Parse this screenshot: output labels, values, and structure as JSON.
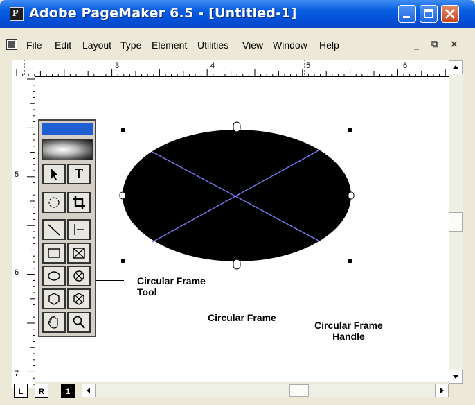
{
  "window": {
    "title": "Adobe PageMaker 6.5 - [Untitled-1]",
    "app_icon_letter": "P",
    "controls": [
      "minimize-icon",
      "maximize-icon",
      "close-icon"
    ]
  },
  "menu": {
    "items": [
      "File",
      "Edit",
      "Layout",
      "Type",
      "Element",
      "Utilities",
      "View",
      "Window",
      "Help"
    ],
    "mdi_controls": [
      "_",
      "⧉",
      "×"
    ]
  },
  "ruler": {
    "top_labels": [
      "3",
      "4",
      "5",
      "6"
    ],
    "left_labels": [
      "5",
      "6",
      "7"
    ]
  },
  "toolbox": {
    "tools": [
      {
        "name": "pointer-tool",
        "icon": "arrow-icon"
      },
      {
        "name": "text-tool",
        "icon": "text-t-icon",
        "label": "T"
      },
      {
        "name": "rotate-tool",
        "icon": "rotate-icon"
      },
      {
        "name": "crop-tool",
        "icon": "crop-icon"
      },
      {
        "name": "line-tool",
        "icon": "diagonal-line-icon"
      },
      {
        "name": "constrained-line-tool",
        "icon": "constrained-line-icon"
      },
      {
        "name": "rectangle-tool",
        "icon": "rectangle-icon"
      },
      {
        "name": "rectangle-frame-tool",
        "icon": "rectangle-frame-icon"
      },
      {
        "name": "ellipse-tool",
        "icon": "ellipse-icon"
      },
      {
        "name": "ellipse-frame-tool",
        "icon": "ellipse-frame-icon"
      },
      {
        "name": "polygon-tool",
        "icon": "polygon-icon"
      },
      {
        "name": "polygon-frame-tool",
        "icon": "polygon-frame-icon"
      },
      {
        "name": "hand-tool",
        "icon": "hand-icon"
      },
      {
        "name": "zoom-tool",
        "icon": "magnifier-icon"
      }
    ]
  },
  "annotations": {
    "tool": "Circular Frame\nTool",
    "frame": "Circular Frame",
    "handle": "Circular Frame\nHandle"
  },
  "page_controls": {
    "left_master": "L",
    "right_master": "R",
    "current_page": "1"
  },
  "colors": {
    "titlebar": "#0a5fe0",
    "frame_fill": "#000000",
    "frame_cross": "#7f7fff",
    "toolbox_title": "#1f5fd1"
  }
}
